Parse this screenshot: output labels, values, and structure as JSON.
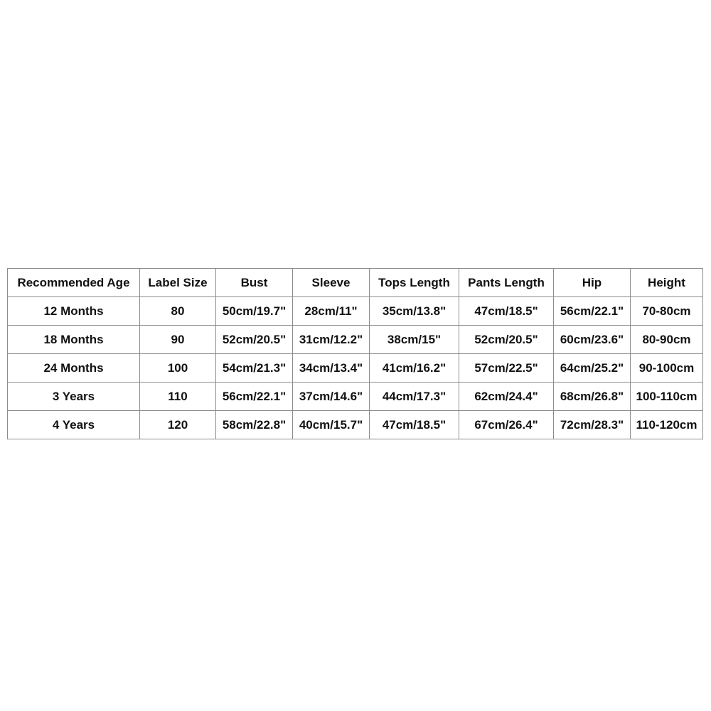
{
  "table": {
    "headers": [
      "Recommended Age",
      "Label Size",
      "Bust",
      "Sleeve",
      "Tops Length",
      "Pants Length",
      "Hip",
      "Height"
    ],
    "rows": [
      [
        "12 Months",
        "80",
        "50cm/19.7\"",
        "28cm/11\"",
        "35cm/13.8\"",
        "47cm/18.5\"",
        "56cm/22.1\"",
        "70-80cm"
      ],
      [
        "18 Months",
        "90",
        "52cm/20.5\"",
        "31cm/12.2\"",
        "38cm/15\"",
        "52cm/20.5\"",
        "60cm/23.6\"",
        "80-90cm"
      ],
      [
        "24 Months",
        "100",
        "54cm/21.3\"",
        "34cm/13.4\"",
        "41cm/16.2\"",
        "57cm/22.5\"",
        "64cm/25.2\"",
        "90-100cm"
      ],
      [
        "3 Years",
        "110",
        "56cm/22.1\"",
        "37cm/14.6\"",
        "44cm/17.3\"",
        "62cm/24.4\"",
        "68cm/26.8\"",
        "100-110cm"
      ],
      [
        "4 Years",
        "120",
        "58cm/22.8\"",
        "40cm/15.7\"",
        "47cm/18.5\"",
        "67cm/26.4\"",
        "72cm/28.3\"",
        "110-120cm"
      ]
    ]
  }
}
